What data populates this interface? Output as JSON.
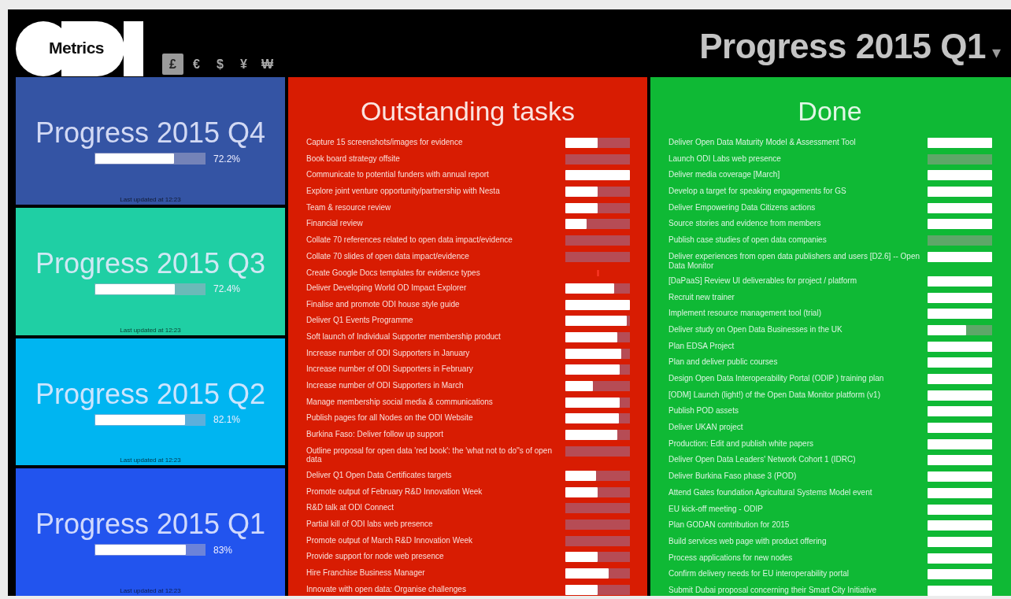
{
  "logo": {
    "label": "Metrics"
  },
  "currencies": [
    {
      "symbol": "£",
      "selected": true
    },
    {
      "symbol": "€",
      "selected": false
    },
    {
      "symbol": "$",
      "selected": false
    },
    {
      "symbol": "¥",
      "selected": false
    },
    {
      "symbol": "₩",
      "selected": false
    }
  ],
  "title": "Progress 2015 Q1",
  "title_caret": "▾",
  "quarters": [
    {
      "title": "Progress 2015 Q4",
      "level": 0.722,
      "reading": "72.2%",
      "updated": "Last updated at 12:23",
      "color": "#3454a4"
    },
    {
      "title": "Progress 2015 Q3",
      "level": 0.724,
      "reading": "72.4%",
      "updated": "Last updated at 12:23",
      "color": "#1fcfa4"
    },
    {
      "title": "Progress 2015 Q2",
      "level": 0.821,
      "reading": "82.1%",
      "updated": "Last updated at 12:23",
      "color": "#00b5f1"
    },
    {
      "title": "Progress 2015 Q1",
      "level": 0.83,
      "reading": "83%",
      "updated": "Last updated at 12:23",
      "color": "#2254ee"
    }
  ],
  "outstanding": {
    "heading": "Outstanding tasks",
    "tasks": [
      {
        "name": "Capture 15 screenshots/images for evidence",
        "kind": "bar",
        "level": 0.5
      },
      {
        "name": "Book board strategy offsite",
        "kind": "bar",
        "level": 0
      },
      {
        "name": "Communicate to potential funders with annual report",
        "kind": "bar",
        "level": 1
      },
      {
        "name": "Explore joint venture opportunity/partnership with Nesta",
        "kind": "bar",
        "level": 0.5
      },
      {
        "name": "Team & resource review",
        "kind": "bar",
        "level": 0.5
      },
      {
        "name": "Financial review",
        "kind": "bar",
        "level": 0.33
      },
      {
        "name": "Collate 70 references related to open data impact/evidence",
        "kind": "bar",
        "level": 0
      },
      {
        "name": "Collate 70 slides of open data impact/evidence",
        "kind": "bar",
        "level": 0
      },
      {
        "name": "Create Google Docs templates for evidence types",
        "kind": "flag"
      },
      {
        "name": "Deliver Developing World OD Impact Explorer",
        "kind": "bar",
        "level": 0.75
      },
      {
        "name": "Finalise and promote ODI house style guide",
        "kind": "bar",
        "level": 1
      },
      {
        "name": "Deliver Q1 Events Programme",
        "kind": "bar",
        "level": 0.95
      },
      {
        "name": "Soft launch of Individual Supporter membership product",
        "kind": "bar",
        "level": 0.8
      },
      {
        "name": "Increase number of ODI Supporters in January",
        "kind": "bar",
        "level": 0.87
      },
      {
        "name": "Increase number of ODI Supporters in February",
        "kind": "bar",
        "level": 0.84
      },
      {
        "name": "Increase number of ODI Supporters in March",
        "kind": "bar",
        "level": 0.43
      },
      {
        "name": "Manage membership social media & communications",
        "kind": "bar",
        "level": 0.84
      },
      {
        "name": "Publish pages for all Nodes on the ODI Website",
        "kind": "bar",
        "level": 0.83
      },
      {
        "name": "Burkina Faso: Deliver follow up support",
        "kind": "bar",
        "level": 0.8
      },
      {
        "name": "Outline proposal for open data 'red book': the 'what not to do''s of open data",
        "kind": "bar",
        "level": 0
      },
      {
        "name": "Deliver Q1 Open Data Certificates targets",
        "kind": "bar",
        "level": 0.47
      },
      {
        "name": "Promote output of February R&D Innovation Week",
        "kind": "bar",
        "level": 0.5
      },
      {
        "name": "R&D talk at ODI Connect",
        "kind": "bar",
        "level": 0
      },
      {
        "name": "Partial kill of ODI labs web presence",
        "kind": "bar",
        "level": 0
      },
      {
        "name": "Promote output of March R&D Innovation Week",
        "kind": "bar",
        "level": 0
      },
      {
        "name": "Provide support for node web presence",
        "kind": "bar",
        "level": 0.5
      },
      {
        "name": "Hire Franchise Business Manager",
        "kind": "bar",
        "level": 0.67
      },
      {
        "name": "Innovate with open data: Organise challenges",
        "kind": "bar",
        "level": 0.5
      }
    ]
  },
  "done": {
    "heading": "Done",
    "tasks": [
      {
        "name": "Deliver Open Data Maturity Model & Assessment Tool",
        "kind": "bar",
        "level": 1
      },
      {
        "name": "Launch ODI Labs web presence",
        "kind": "bar",
        "level": 0
      },
      {
        "name": "Deliver media coverage [March]",
        "kind": "bar",
        "level": 1
      },
      {
        "name": "Develop a target for speaking engagements for GS",
        "kind": "bar",
        "level": 1
      },
      {
        "name": "Deliver Empowering Data Citizens actions",
        "kind": "bar",
        "level": 1
      },
      {
        "name": "Source stories and evidence from members",
        "kind": "bar",
        "level": 1
      },
      {
        "name": "Publish case studies of open data companies",
        "kind": "bar",
        "level": 0
      },
      {
        "name": "Deliver experiences from open data publishers and users [D2.6] -- Open Data Monitor",
        "kind": "bar",
        "level": 1
      },
      {
        "name": "[DaPaaS] Review UI deliverables for project / platform",
        "kind": "bar",
        "level": 1
      },
      {
        "name": "Recruit new trainer",
        "kind": "bar",
        "level": 1
      },
      {
        "name": "Implement resource management tool (trial)",
        "kind": "bar",
        "level": 1
      },
      {
        "name": "Deliver study on Open Data Businesses in the UK",
        "kind": "bar",
        "level": 0.6
      },
      {
        "name": "Plan EDSA Project",
        "kind": "bar",
        "level": 1
      },
      {
        "name": "Plan and deliver public courses",
        "kind": "bar",
        "level": 1
      },
      {
        "name": "Design Open Data Interoperability Portal (ODIP ) training plan",
        "kind": "bar",
        "level": 1
      },
      {
        "name": "[ODM] Launch (light!) of the Open Data Monitor platform (v1)",
        "kind": "bar",
        "level": 1
      },
      {
        "name": "Publish POD assets",
        "kind": "bar",
        "level": 1
      },
      {
        "name": "Deliver UKAN project",
        "kind": "bar",
        "level": 1
      },
      {
        "name": "Production: Edit and publish white papers",
        "kind": "bar",
        "level": 1
      },
      {
        "name": "Deliver Open Data Leaders' Network Cohort 1 (IDRC)",
        "kind": "bar",
        "level": 1
      },
      {
        "name": "Deliver Burkina Faso phase 3 (POD)",
        "kind": "bar",
        "level": 1
      },
      {
        "name": "Attend Gates foundation Agricultural Systems Model event",
        "kind": "bar",
        "level": 1
      },
      {
        "name": "EU kick-off meeting - ODIP",
        "kind": "bar",
        "level": 1
      },
      {
        "name": "Plan GODAN contribution for 2015",
        "kind": "bar",
        "level": 1
      },
      {
        "name": "Build services web page with product offering",
        "kind": "bar",
        "level": 1
      },
      {
        "name": "Process applications for new nodes",
        "kind": "bar",
        "level": 1
      },
      {
        "name": "Confirm delivery needs for EU interoperability portal",
        "kind": "bar",
        "level": 1
      },
      {
        "name": "Submit Dubai proposal concerning their Smart City Initiative",
        "kind": "bar",
        "level": 1
      }
    ]
  }
}
